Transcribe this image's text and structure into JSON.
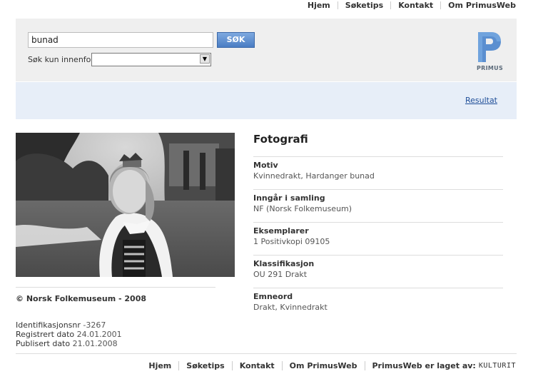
{
  "topnav": {
    "items": [
      "Hjem",
      "Søketips",
      "Kontakt",
      "Om PrimusWeb"
    ]
  },
  "search": {
    "value": "bunad",
    "button_label": "SØK",
    "within_label": "Søk kun innenfor:",
    "within_selected": ""
  },
  "logo": {
    "text": "PRIMUS",
    "color": "#5b8fd0"
  },
  "result_link": "Resultat",
  "record": {
    "title": "Fotografi",
    "fields": [
      {
        "label": "Motiv",
        "value": "Kvinnedrakt, Hardanger bunad"
      },
      {
        "label": "Inngår i samling",
        "value": "NF (Norsk Folkemuseum)"
      },
      {
        "label": "Eksemplarer",
        "value": "1 Positivkopi 09105"
      },
      {
        "label": "Klassifikasjon",
        "value": "OU 291 Drakt"
      },
      {
        "label": "Emneord",
        "value": "Drakt, Kvinnedrakt"
      }
    ],
    "copyright": "© Norsk Folkemuseum - 2008",
    "meta": {
      "id_label": "Identifikasjonsnr",
      "id_value": "-3267",
      "reg_label": "Registrert dato",
      "reg_value": "24.01.2001",
      "pub_label": "Publisert dato",
      "pub_value": "21.01.2008"
    }
  },
  "footer": {
    "items": [
      "Hjem",
      "Søketips",
      "Kontakt",
      "Om PrimusWeb"
    ],
    "credit": "PrimusWeb er laget av:",
    "credit_brand": "KULTURIT"
  },
  "colors": {
    "panel_bg": "#efefef",
    "result_bar_bg": "#e7eef8",
    "link": "#1f4e98",
    "button": "#4a7dc3"
  }
}
